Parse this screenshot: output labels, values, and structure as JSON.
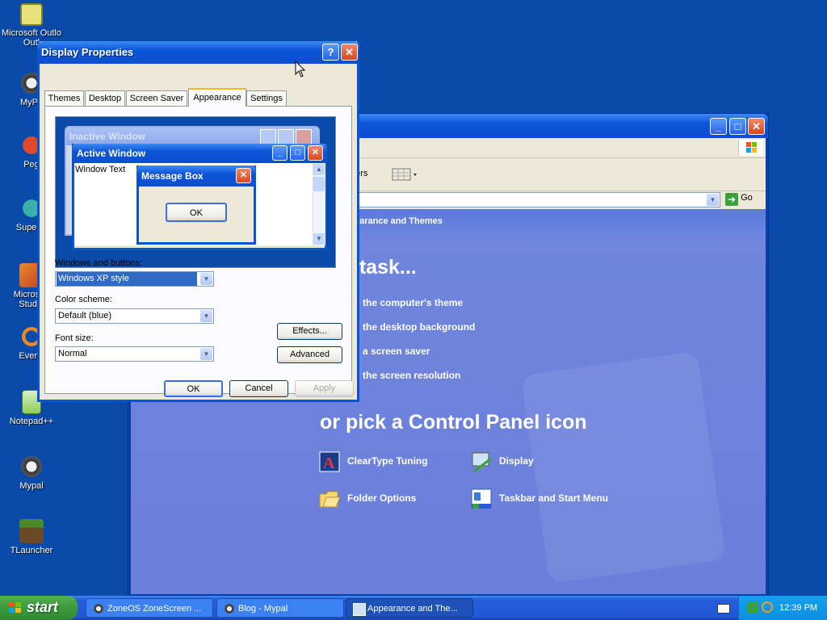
{
  "desktop": {
    "icons": [
      {
        "label": "Microsoft Outlook",
        "short": "Microsoft Outlo",
        "icon": "outlook-icon"
      },
      {
        "label": "MyPal",
        "short": "MyPa",
        "icon": "mypal-icon"
      },
      {
        "label": "Pegasus",
        "short": "Peg",
        "icon": "pegasus-icon"
      },
      {
        "label": "Superm",
        "short": "Superm",
        "icon": "superm-icon"
      },
      {
        "label": "Microsoft Studio",
        "short": "Microsoft Studio",
        "icon": "studio-icon"
      },
      {
        "label": "Everything",
        "short": "Everyt",
        "icon": "everything-icon"
      },
      {
        "label": "Notepad++",
        "short": "Notepad++",
        "icon": "notepadpp-icon"
      },
      {
        "label": "Mypal",
        "short": "Mypal",
        "icon": "mypal-icon"
      },
      {
        "label": "TLauncher",
        "short": "TLauncher",
        "icon": "tlauncher-icon"
      }
    ]
  },
  "control_panel": {
    "breadcrumb_text": "earance and Themes",
    "toolbar_folders": "ders",
    "go_label": "Go",
    "pick_task_title": "a task...",
    "tasks": [
      "e the computer's theme",
      "e the desktop background",
      "e a screen saver",
      "e the screen resolution"
    ],
    "pick_icon_title": "or pick a Control Panel icon",
    "icons": [
      {
        "label": "ClearType Tuning",
        "icon": "cleartype-icon"
      },
      {
        "label": "Display",
        "icon": "display-icon"
      },
      {
        "label": "Folder Options",
        "icon": "folder-options-icon"
      },
      {
        "label": "Taskbar and Start Menu",
        "icon": "taskbar-start-menu-icon"
      }
    ]
  },
  "dialog": {
    "title": "Display Properties",
    "help_label": "?",
    "tabs": [
      "Themes",
      "Desktop",
      "Screen Saver",
      "Appearance",
      "Settings"
    ],
    "active_tab": "Appearance",
    "preview": {
      "inactive_title": "Inactive Window",
      "active_title": "Active Window",
      "window_text": "Window Text",
      "message_box_title": "Message Box",
      "ok_label": "OK"
    },
    "windows_buttons_label": "Windows and buttons:",
    "windows_buttons_value": "Windows XP style",
    "color_scheme_label": "Color scheme:",
    "color_scheme_value": "Default (blue)",
    "font_size_label": "Font size:",
    "font_size_value": "Normal",
    "effects_label": "Effects...",
    "advanced_label": "Advanced",
    "ok_label": "OK",
    "cancel_label": "Cancel",
    "apply_label": "Apply"
  },
  "taskbar": {
    "start_label": "start",
    "buttons": [
      {
        "label": "ZoneOS ZoneScreen ...",
        "icon": "zonescreen-icon"
      },
      {
        "label": "Blog - Mypal",
        "icon": "mypal-icon"
      },
      {
        "label": "Appearance and The...",
        "icon": "appearance-icon"
      }
    ],
    "clock": "12:39 PM"
  },
  "colors": {
    "desktop": "#0a4aa8",
    "title_blue": "#0c55d8",
    "dialog_face": "#ece9d8",
    "start_green": "#3c9a3c"
  }
}
